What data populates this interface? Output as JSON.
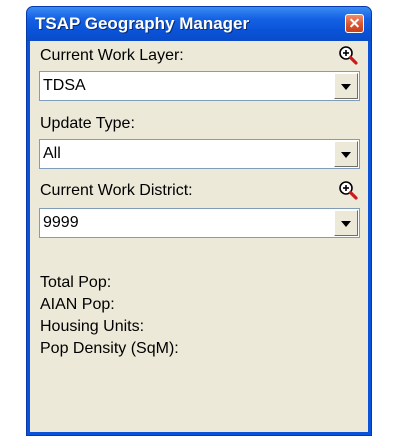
{
  "window": {
    "title": "TSAP Geography Manager"
  },
  "work_layer": {
    "label": "Current Work Layer:",
    "value": "TDSA"
  },
  "update_type": {
    "label": "Update Type:",
    "value": "All"
  },
  "work_district": {
    "label": "Current Work District:",
    "value": "9999"
  },
  "stats": [
    {
      "label": "Total Pop:"
    },
    {
      "label": "AIAN Pop:"
    },
    {
      "label": "Housing Units:"
    },
    {
      "label": "Pop Density (SqM):"
    }
  ],
  "icons": {
    "zoom": "zoom-in-icon",
    "close": "close-icon",
    "dropdown": "chevron-down-icon"
  },
  "colors": {
    "titlebar": "#0a53d8",
    "client_bg": "#ece9d8",
    "close_button": "#d9512a"
  }
}
